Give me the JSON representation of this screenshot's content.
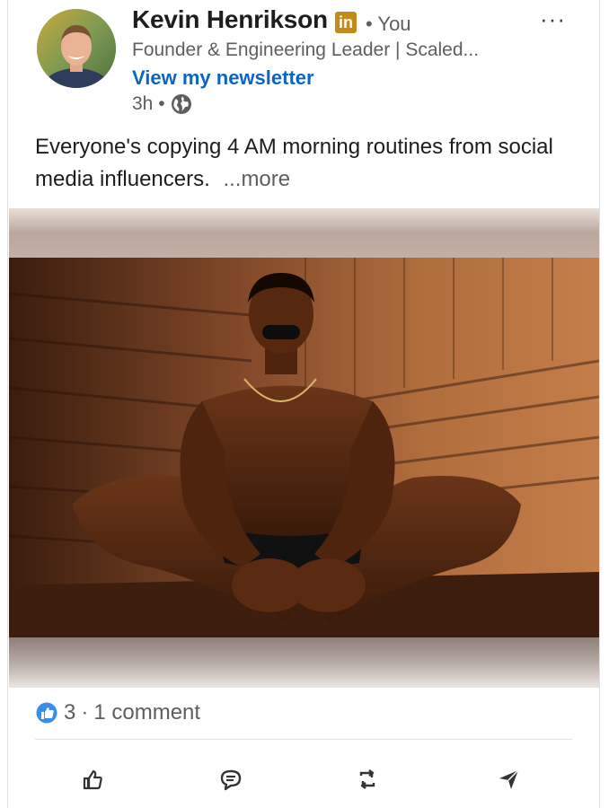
{
  "post": {
    "author": {
      "name": "Kevin Henrikson",
      "badge_text": "in",
      "degree": "• You",
      "headline": "Founder & Engineering Leader | Scaled...",
      "newsletter_link": "View my newsletter",
      "timestamp": "3h •",
      "visibility_icon": "globe-icon"
    },
    "menu_icon": "more-options-icon",
    "menu_label": "···",
    "body_text": "Everyone's copying 4 AM morning routines from social media influencers.",
    "see_more": "...more",
    "image": {
      "description_icon": "post-image"
    },
    "social_counts": {
      "reactions": "3",
      "separator": "·",
      "comments": "1 comment"
    },
    "actions": [
      {
        "name": "like",
        "icon": "thumbs-up-icon"
      },
      {
        "name": "comment",
        "icon": "comment-icon"
      },
      {
        "name": "repost",
        "icon": "repost-icon"
      },
      {
        "name": "send",
        "icon": "send-icon"
      }
    ]
  },
  "colors": {
    "link_blue": "#0a66c2",
    "badge_gold": "#c48a1a",
    "secondary_text": "#5e5e5e",
    "reaction_blue": "#378fe9"
  }
}
